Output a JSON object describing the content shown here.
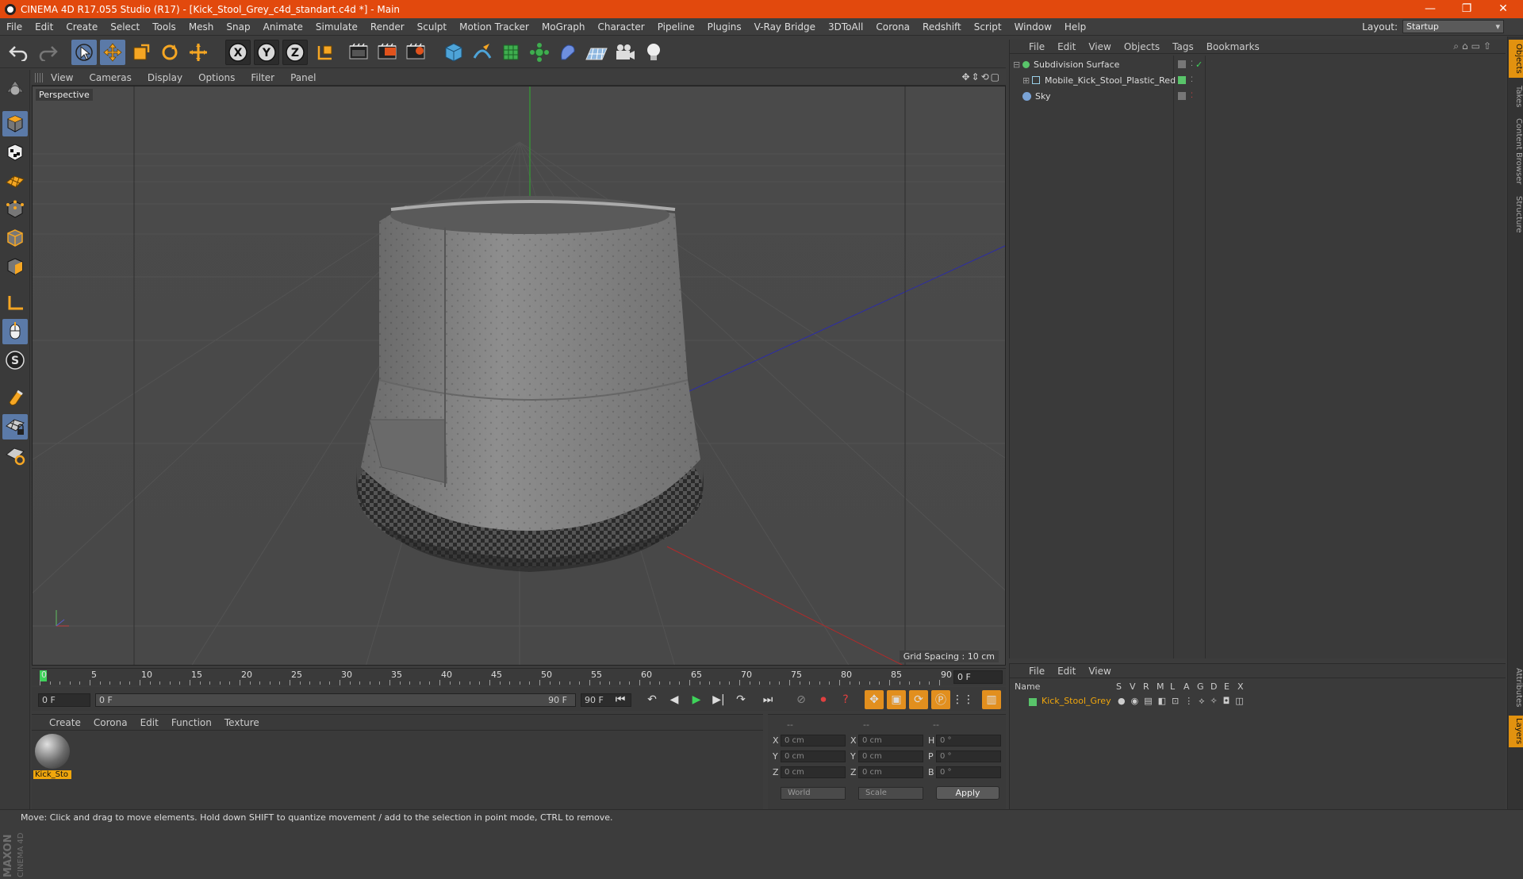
{
  "window": {
    "title": "CINEMA 4D R17.055 Studio (R17) - [Kick_Stool_Grey_c4d_standart.c4d *] - Main",
    "minimize": "—",
    "restore": "❐",
    "close": "✕"
  },
  "menubar": {
    "items": [
      "File",
      "Edit",
      "Create",
      "Select",
      "Tools",
      "Mesh",
      "Snap",
      "Animate",
      "Simulate",
      "Render",
      "Sculpt",
      "Motion Tracker",
      "MoGraph",
      "Character",
      "Pipeline",
      "Plugins",
      "V-Ray Bridge",
      "3DToAll",
      "Corona",
      "Redshift",
      "Script",
      "Window",
      "Help"
    ],
    "layout_label": "Layout:",
    "layout_value": "Startup"
  },
  "toolbar": {
    "axis_x": "X",
    "axis_y": "Y",
    "axis_z": "Z"
  },
  "viewport": {
    "menu": [
      "View",
      "Cameras",
      "Display",
      "Options",
      "Filter",
      "Panel"
    ],
    "label": "Perspective",
    "grid_spacing": "Grid Spacing : 10 cm"
  },
  "timeline": {
    "ticks": [
      "0",
      "5",
      "10",
      "15",
      "20",
      "25",
      "30",
      "35",
      "40",
      "45",
      "50",
      "55",
      "60",
      "65",
      "70",
      "75",
      "80",
      "85",
      "90"
    ],
    "current_frame": "0 F"
  },
  "transport": {
    "start_field": "0 F",
    "range_start": "0 F",
    "range_end": "90 F",
    "end_field": "90 F"
  },
  "material_manager": {
    "menu": [
      "Create",
      "Corona",
      "Edit",
      "Function",
      "Texture"
    ],
    "material_label": "Kick_Sto"
  },
  "coordinates": {
    "headers": [
      "--",
      "--",
      "--"
    ],
    "rows": [
      {
        "axis": "X",
        "pos": "0 cm",
        "axis2": "X",
        "size": "0 cm",
        "rot_lbl": "H",
        "rot": "0 °"
      },
      {
        "axis": "Y",
        "pos": "0 cm",
        "axis2": "Y",
        "size": "0 cm",
        "rot_lbl": "P",
        "rot": "0 °"
      },
      {
        "axis": "Z",
        "pos": "0 cm",
        "axis2": "Z",
        "size": "0 cm",
        "rot_lbl": "B",
        "rot": "0 °"
      }
    ],
    "mode": "World",
    "scale": "Scale",
    "apply": "Apply"
  },
  "object_manager": {
    "menu": [
      "File",
      "Edit",
      "View",
      "Objects",
      "Tags",
      "Bookmarks"
    ],
    "objects": [
      {
        "name": "Subdivision Surface",
        "color": "#59c46a"
      },
      {
        "name": "Mobile_Kick_Stool_Plastic_Red",
        "color": "#9ad0e8"
      },
      {
        "name": "Sky",
        "color": "#7aa3d6"
      }
    ]
  },
  "layer_manager": {
    "menu": [
      "File",
      "Edit",
      "View"
    ],
    "columns": [
      "Name",
      "S",
      "V",
      "R",
      "M",
      "L",
      "A",
      "G",
      "D",
      "E",
      "X"
    ],
    "layer_name": "Kick_Stool_Grey",
    "layer_color": "#59c46a"
  },
  "side_tabs": [
    "Objects",
    "Takes",
    "Content Browser",
    "Structure"
  ],
  "side_tabs_bottom": [
    "Attributes",
    "Layers"
  ],
  "logo": {
    "line1": "MAXON",
    "line2": "CINEMA 4D"
  },
  "statusbar": {
    "text": "Move: Click and drag to move elements. Hold down SHIFT to quantize movement / add to the selection in point mode, CTRL to remove."
  }
}
